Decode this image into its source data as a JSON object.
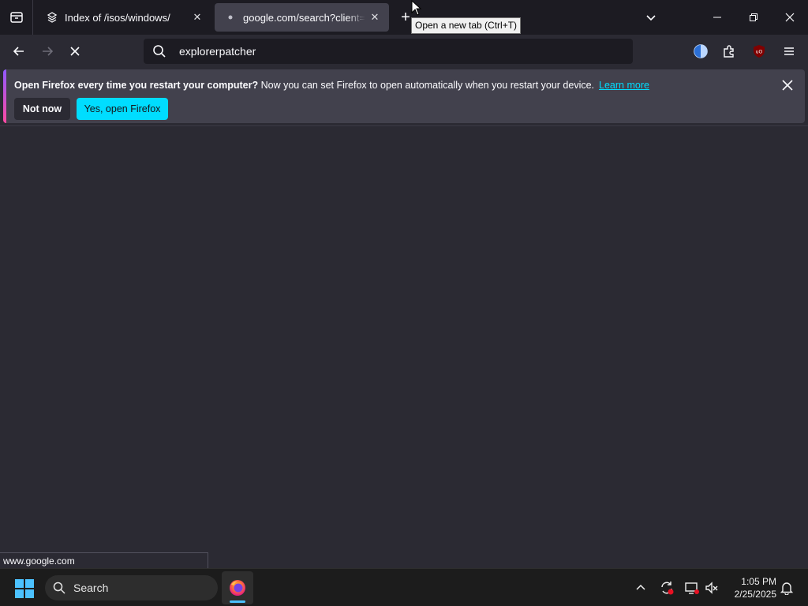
{
  "tabs": [
    {
      "title": "Index of /isos/windows/",
      "active": false
    },
    {
      "title": "google.com/search?client=firefox-b-d&q=explorerpatcher",
      "active": true
    }
  ],
  "tooltip": "Open a new tab (Ctrl+T)",
  "url_bar": {
    "value": "explorerpatcher"
  },
  "notification": {
    "bold": "Open Firefox every time you restart your computer?",
    "text": " Now you can set Firefox to open automatically when you restart your device.",
    "link": "Learn more",
    "not_now": "Not now",
    "yes": "Yes, open Firefox"
  },
  "status_url": "www.google.com",
  "taskbar": {
    "search_label": "Search",
    "time": "1:05 PM",
    "date": "2/25/2025"
  },
  "colors": {
    "accent": "#00ddff",
    "toolbar": "#2b2a33",
    "tabstrip": "#1c1b22"
  }
}
